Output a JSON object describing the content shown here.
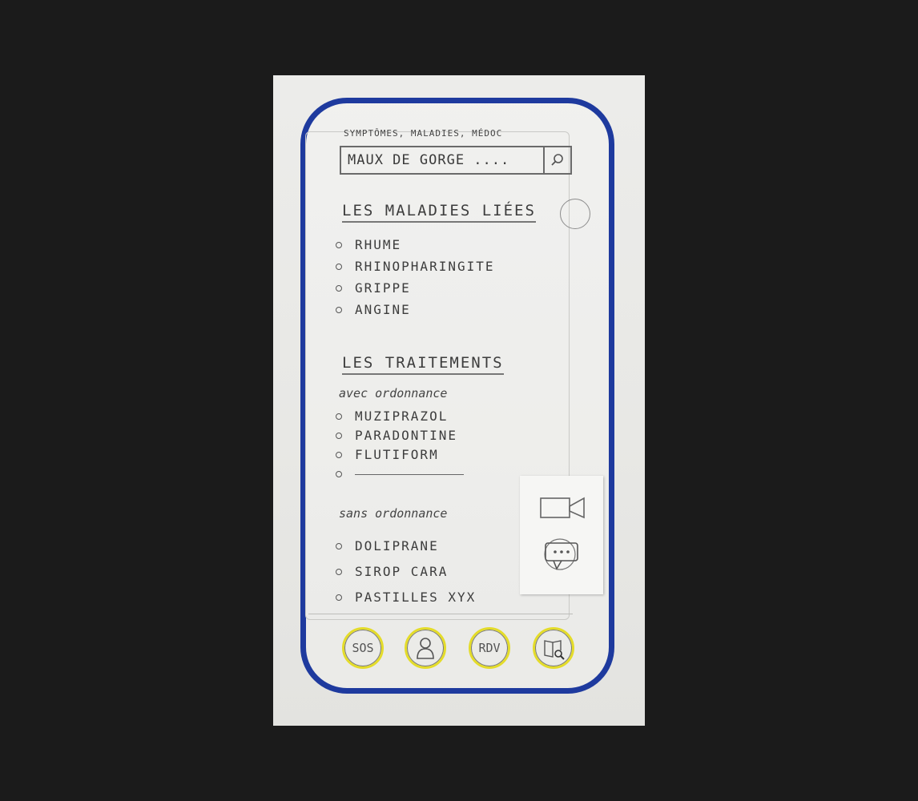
{
  "search": {
    "label": "SYMPTÔMES, MALADIES, MÉDOC",
    "value": "MAUX DE GORGE ...."
  },
  "diseases": {
    "title": "LES MALADIES LIÉES",
    "items": [
      "RHUME",
      "RHINOPHARINGITE",
      "GRIPPE",
      "ANGINE"
    ]
  },
  "treatments": {
    "title": "LES TRAITEMENTS",
    "with_prescription_label": "avec ordonnance",
    "with_prescription": [
      "MUZIPRAZOL",
      "PARADONTINE",
      "FLUTIFORM"
    ],
    "without_prescription_label": "sans ordonnance",
    "without_prescription": [
      "DOLIPRANE",
      "SIROP CARA",
      "PASTILLES XYX"
    ]
  },
  "tabbar": {
    "sos_label": "SOS",
    "rdv_label": "RDV",
    "icons": [
      "sos-button",
      "profile-icon",
      "rdv-button",
      "book-search-icon"
    ]
  },
  "colors": {
    "phone_frame": "#1e3a9e",
    "tab_ring": "#e4dc2a"
  }
}
